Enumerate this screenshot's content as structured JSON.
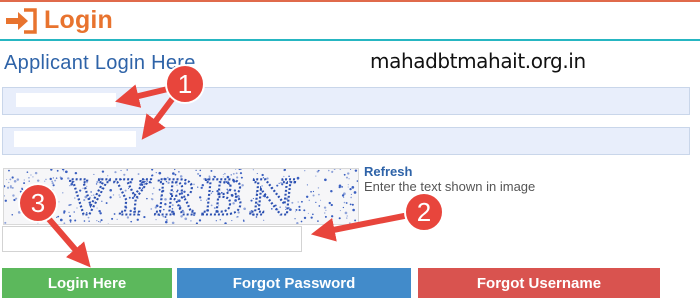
{
  "header": {
    "title": "Login",
    "icon": "sign-in-icon",
    "accent": "#e8732e"
  },
  "form": {
    "subtitle": "Applicant Login Here",
    "username_value": "",
    "password_value": "",
    "captcha": {
      "text": "VYRBN",
      "refresh_label": "Refresh",
      "instruction": "Enter the text shown in image",
      "input_value": ""
    }
  },
  "buttons": {
    "login": "Login Here",
    "forgot_password": "Forgot Password",
    "forgot_username": "Forgot Username"
  },
  "annotations": {
    "site": "mahadbtmahait.org.in",
    "markers": [
      "1",
      "2",
      "3"
    ],
    "marker_color": "#e8453c"
  }
}
